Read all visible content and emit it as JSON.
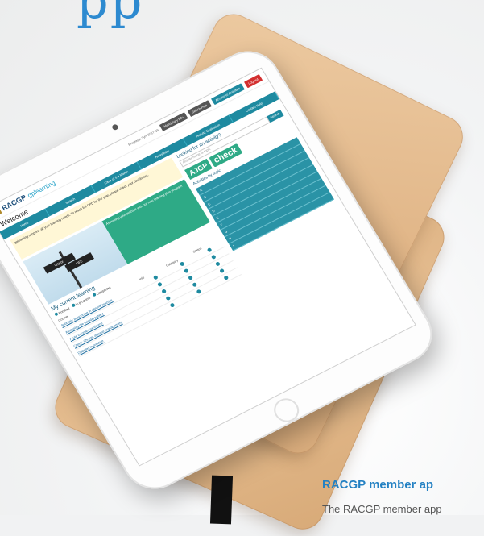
{
  "heading_peek": "pp",
  "tablet_screen": {
    "logo": "RACGP",
    "logo_sub": "gplearning",
    "progress_text": "Progress: 3yrs 2017-19",
    "buttons": [
      "Mandatory Info",
      "Switch Plan",
      "Access to Activities",
      "Log out"
    ],
    "welcome": "Welcome",
    "nav": [
      "Home",
      "Search",
      "Case of the Month",
      "Newsletter",
      "Activity Evaluation",
      "Contact Help"
    ],
    "intro_text": "gplearning supports all your learning needs. To reach full CPD for the year, please check your dashboard.",
    "sign_labels": [
      "WORK",
      "LIFE"
    ],
    "promo_text": "Assessing your practice with our new learning plan program",
    "section_title": "My current learning",
    "legend": [
      "Enrolled",
      "In progress",
      "Completed"
    ],
    "table_headers": [
      "Course",
      "Info",
      "Category",
      "Status"
    ],
    "courses": [
      "Antibiotic prescribing in general practice",
      "Assessing the suicidal patient",
      "Acute coronary syndrome",
      "Check: Chronic disease management",
      "Diabetes in practice"
    ],
    "right_title": "Looking for an activity?",
    "search_placeholder": "Activity name or topic",
    "search_button": "Search",
    "ajgp": "AJGP",
    "check": "check",
    "by_topic": "Activities by topic",
    "topics": [
      "A",
      "B",
      "C",
      "D",
      "E",
      "F",
      "G",
      "H",
      "I"
    ]
  },
  "teaser": {
    "title": "RACGP member ap",
    "text": "The RACGP member app"
  }
}
